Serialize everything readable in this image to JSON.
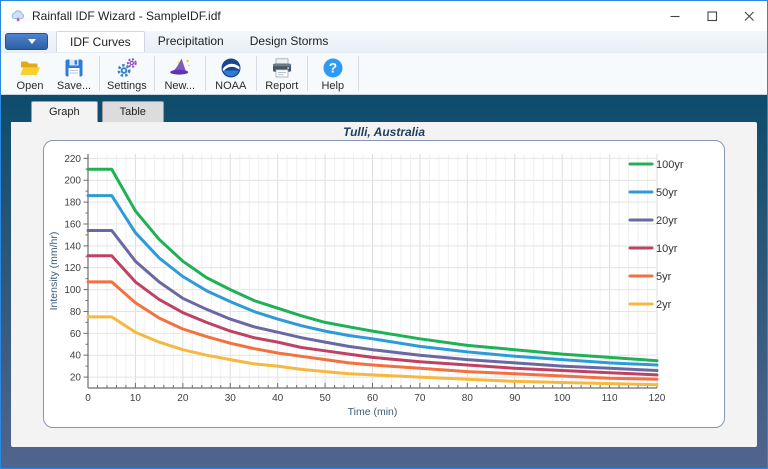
{
  "window": {
    "title": "Rainfall IDF Wizard - SampleIDF.idf"
  },
  "menu": {
    "tabs": [
      {
        "label": "IDF Curves",
        "selected": true
      },
      {
        "label": "Precipitation",
        "selected": false
      },
      {
        "label": "Design Storms",
        "selected": false
      }
    ]
  },
  "toolbar": {
    "buttons": [
      {
        "label": "Open",
        "icon": "open-folder-icon"
      },
      {
        "label": "Save...",
        "icon": "save-floppy-icon"
      },
      {
        "label": "Settings",
        "icon": "gears-icon"
      },
      {
        "label": "New...",
        "icon": "wizard-hat-icon"
      },
      {
        "label": "NOAA",
        "icon": "noaa-logo-icon"
      },
      {
        "label": "Report",
        "icon": "printer-icon"
      },
      {
        "label": "Help",
        "icon": "help-question-icon"
      }
    ]
  },
  "doc_tabs": [
    {
      "label": "Graph",
      "selected": true
    },
    {
      "label": "Table",
      "selected": false
    }
  ],
  "chart_data": {
    "type": "line",
    "title": "Tulli, Australia",
    "xlabel": "Time (min)",
    "ylabel": "Intensity (mm/hr)",
    "xlim": [
      0,
      120
    ],
    "ylim": [
      10,
      224
    ],
    "x_major_step": 10,
    "x_minor_step": 2,
    "y_major_step": 20,
    "y_minor_step": 10,
    "y_ticks": [
      20,
      40,
      60,
      80,
      100,
      120,
      140,
      160,
      180,
      200,
      220
    ],
    "x_ticks": [
      0,
      10,
      20,
      30,
      40,
      50,
      60,
      70,
      80,
      90,
      100,
      110,
      120
    ],
    "grid": true,
    "legend_position": "right",
    "x": [
      0,
      5,
      10,
      15,
      20,
      25,
      30,
      35,
      40,
      45,
      50,
      55,
      60,
      70,
      80,
      90,
      100,
      110,
      120
    ],
    "series": [
      {
        "name": "100yr",
        "color": "#1eb155",
        "values": [
          210,
          210,
          172,
          146,
          126,
          111,
          100,
          90,
          83,
          76,
          70,
          66,
          62,
          55,
          49,
          45,
          41,
          38,
          35
        ]
      },
      {
        "name": "50yr",
        "color": "#2d9bd8",
        "values": [
          186,
          186,
          152,
          129,
          112,
          99,
          89,
          80,
          73,
          67,
          62,
          58,
          55,
          48,
          43,
          39,
          36,
          33,
          31
        ]
      },
      {
        "name": "20yr",
        "color": "#6968a3",
        "values": [
          154,
          154,
          126,
          107,
          92,
          82,
          73,
          66,
          61,
          56,
          52,
          48,
          45,
          40,
          36,
          33,
          30,
          28,
          26
        ]
      },
      {
        "name": "10yr",
        "color": "#bf4263",
        "values": [
          131,
          131,
          107,
          91,
          79,
          70,
          62,
          56,
          52,
          47,
          44,
          41,
          38,
          34,
          31,
          28,
          26,
          24,
          22
        ]
      },
      {
        "name": "5yr",
        "color": "#f4713f",
        "values": [
          107,
          107,
          88,
          74,
          64,
          57,
          51,
          46,
          42,
          39,
          36,
          33,
          31,
          28,
          25,
          23,
          21,
          19,
          18
        ]
      },
      {
        "name": "2yr",
        "color": "#f6b83f",
        "values": [
          75,
          75,
          61,
          52,
          45,
          40,
          36,
          32,
          30,
          27,
          25,
          23,
          22,
          20,
          18,
          16,
          15,
          14,
          13
        ]
      }
    ]
  },
  "colors": {
    "window_border": "#2b88e0",
    "frame_gradient_top": "#0e4c6b",
    "frame_gradient_bottom": "#50658d",
    "ribbon_bg": "#f6fafd",
    "app_button_blue": "#2d5fa6",
    "chart_title_navy": "#1f3d5c",
    "panel_gray": "#f3f3f3"
  }
}
